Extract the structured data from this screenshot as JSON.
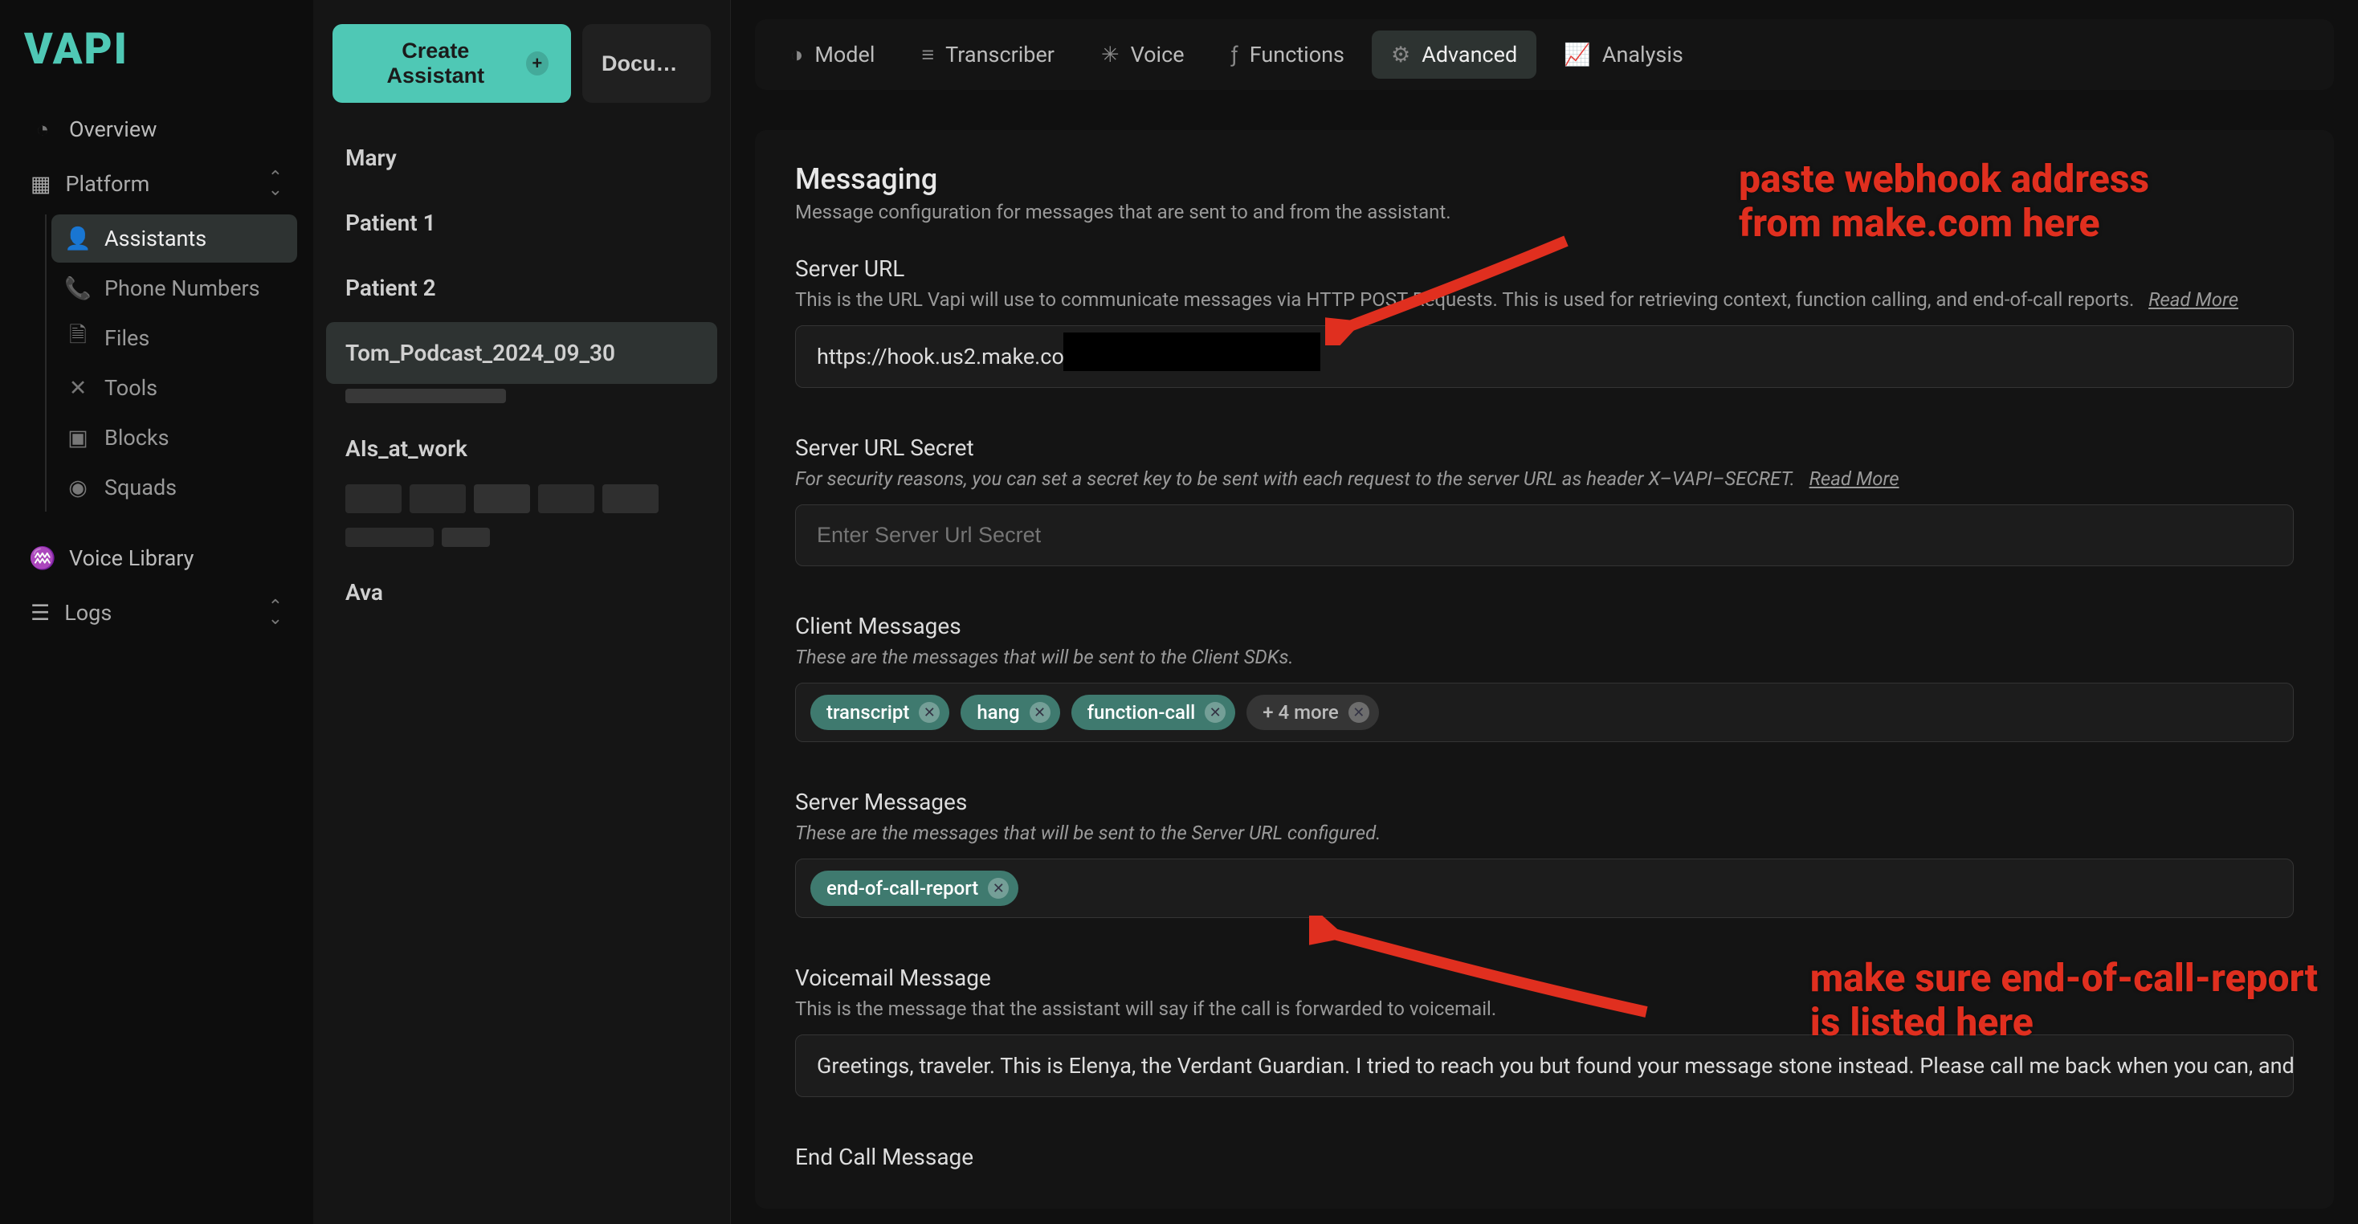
{
  "brand": "VAPI",
  "sidebar": {
    "overview": "Overview",
    "platform": "Platform",
    "items": [
      {
        "label": "Assistants"
      },
      {
        "label": "Phone Numbers"
      },
      {
        "label": "Files"
      },
      {
        "label": "Tools"
      },
      {
        "label": "Blocks"
      },
      {
        "label": "Squads"
      }
    ],
    "voice_library": "Voice Library",
    "logs": "Logs"
  },
  "list": {
    "create_btn": "Create Assistant",
    "doc_btn": "Docume...",
    "items": [
      {
        "name": "Mary"
      },
      {
        "name": "Patient 1"
      },
      {
        "name": "Patient 2"
      },
      {
        "name": "Tom_Podcast_2024_09_30"
      },
      {
        "name": "AIs_at_work"
      },
      {
        "name": "Ava"
      }
    ]
  },
  "tabs": [
    {
      "label": "Model"
    },
    {
      "label": "Transcriber"
    },
    {
      "label": "Voice"
    },
    {
      "label": "Functions"
    },
    {
      "label": "Advanced"
    },
    {
      "label": "Analysis"
    }
  ],
  "messaging": {
    "title": "Messaging",
    "subtitle": "Message configuration for messages that are sent to and from the assistant.",
    "server_url": {
      "label": "Server URL",
      "help": "This is the URL Vapi will use to communicate messages via HTTP POST Requests. This is used for retrieving context, function calling, and end-of-call reports.",
      "readmore": "Read More",
      "value": "https://hook.us2.make.com/"
    },
    "server_secret": {
      "label": "Server URL Secret",
      "help": "For security reasons, you can set a secret key to be sent with each request to the server URL as header X–VAPI–SECRET.",
      "readmore": "Read More",
      "placeholder": "Enter Server Url Secret"
    },
    "client_messages": {
      "label": "Client Messages",
      "help": "These are the messages that will be sent to the Client SDKs.",
      "tags": [
        "transcript",
        "hang",
        "function-call"
      ],
      "more": "+ 4 more"
    },
    "server_messages": {
      "label": "Server Messages",
      "help": "These are the messages that will be sent to the Server URL configured.",
      "tags": [
        "end-of-call-report"
      ]
    },
    "voicemail": {
      "label": "Voicemail Message",
      "help": "This is the message that the assistant will say if the call is forwarded to voicemail.",
      "value": "Greetings, traveler. This is Elenya, the Verdant Guardian. I tried to reach you but found your message stone instead. Please call me back when you can, and we shall continue our journey t"
    },
    "end_call": {
      "label": "End Call Message"
    }
  },
  "annotations": {
    "a1_line1": "paste webhook address",
    "a1_line2": "from make.com here",
    "a2_line1": "make sure end-of-call-report",
    "a2_line2": "is listed here"
  }
}
